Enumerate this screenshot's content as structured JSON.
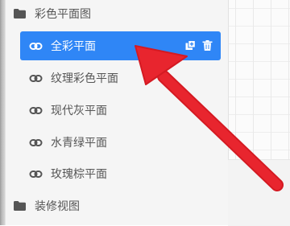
{
  "tree": {
    "group1": {
      "label": "彩色平面图",
      "icon": "folder-icon"
    },
    "items": [
      {
        "label": "全彩平面",
        "icon": "link-icon",
        "active": true
      },
      {
        "label": "纹理彩色平面",
        "icon": "link-icon"
      },
      {
        "label": "现代灰平面",
        "icon": "link-icon"
      },
      {
        "label": "水青绿平面",
        "icon": "link-icon"
      },
      {
        "label": "玫瑰棕平面",
        "icon": "link-icon"
      }
    ],
    "group2": {
      "label": "装修视图",
      "icon": "folder-icon"
    },
    "active_actions": {
      "copy_icon": "copy-icon",
      "delete_icon": "trash-icon"
    }
  },
  "colors": {
    "active": "#2f86f6",
    "arrow": "#e8202a",
    "text": "#555555"
  }
}
